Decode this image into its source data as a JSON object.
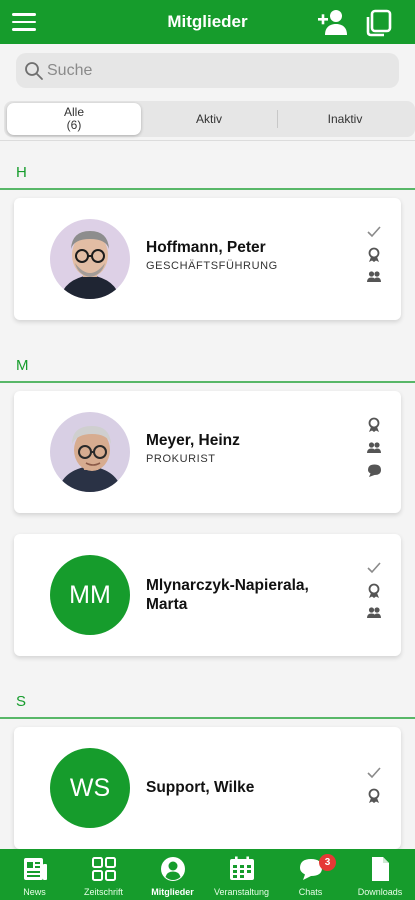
{
  "header": {
    "title": "Mitglieder",
    "menu_icon": "hamburger-menu-icon",
    "add_icon": "add-user-icon",
    "copy_icon": "copy-icon",
    "accent_color": "#169c2c"
  },
  "search": {
    "placeholder": "Suche",
    "value": ""
  },
  "segments": [
    {
      "label": "Alle",
      "count": "(6)",
      "active": true
    },
    {
      "label": "Aktiv",
      "active": false
    },
    {
      "label": "Inaktiv",
      "active": false
    }
  ],
  "sections": [
    {
      "letter": "H",
      "members": [
        {
          "name": "Hoffmann, Peter",
          "role": "GESCHÄFTSFÜHRUNG",
          "avatar": "photo",
          "status_icons": [
            "check-icon",
            "award-icon",
            "group-icon"
          ]
        }
      ]
    },
    {
      "letter": "M",
      "members": [
        {
          "name": "Meyer, Heinz",
          "role": "PROKURIST",
          "avatar": "photo",
          "status_icons": [
            "award-icon",
            "group-icon",
            "chat-icon"
          ]
        },
        {
          "name_line1": "Mlynarczyk-Napierala,",
          "name_line2": "Marta",
          "initials": "MM",
          "avatar": "initials",
          "status_icons": [
            "check-icon",
            "award-icon",
            "group-icon"
          ]
        }
      ]
    },
    {
      "letter": "S",
      "members": [
        {
          "name": "Support, Wilke",
          "initials": "WS",
          "avatar": "initials",
          "status_icons": [
            "check-icon",
            "award-icon"
          ]
        }
      ]
    }
  ],
  "bottom_nav": [
    {
      "label": "News",
      "icon": "newspaper-icon"
    },
    {
      "label": "Zeitschrift",
      "icon": "grid-icon"
    },
    {
      "label": "Mitglieder",
      "icon": "person-icon",
      "active": true
    },
    {
      "label": "Veranstaltung",
      "icon": "calendar-icon"
    },
    {
      "label": "Chats",
      "icon": "chat-bubble-icon",
      "badge": "3"
    },
    {
      "label": "Downloads",
      "icon": "document-icon"
    }
  ]
}
